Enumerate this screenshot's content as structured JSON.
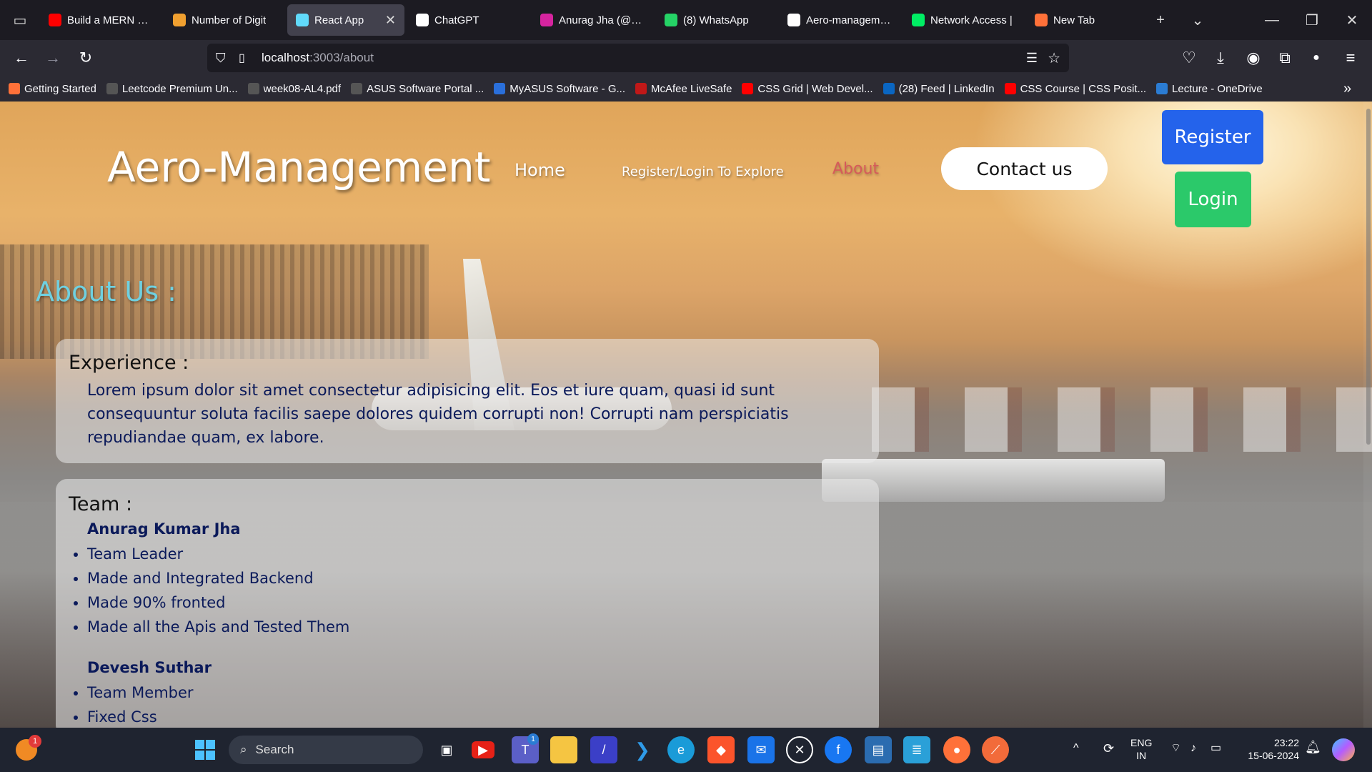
{
  "browser": {
    "tabs": [
      {
        "label": "Build a MERN Rea",
        "icon": "youtube-icon",
        "color": "#ff0000",
        "active": false
      },
      {
        "label": "Number of Digit",
        "icon": "code-icon",
        "color": "#f0a030",
        "active": false
      },
      {
        "label": "React App",
        "icon": "react-icon",
        "color": "#61dafb",
        "active": true
      },
      {
        "label": "ChatGPT",
        "icon": "chatgpt-icon",
        "color": "#ffffff",
        "active": false
      },
      {
        "label": "Anurag Jha (@anu",
        "icon": "instagram-icon",
        "color": "#d6249f",
        "active": false
      },
      {
        "label": "(8) WhatsApp",
        "icon": "whatsapp-icon",
        "color": "#25d366",
        "active": false
      },
      {
        "label": "Aero-managemen",
        "icon": "github-icon",
        "color": "#ffffff",
        "active": false
      },
      {
        "label": "Network Access |",
        "icon": "mongodb-icon",
        "color": "#00ed64",
        "active": false
      },
      {
        "label": "New Tab",
        "icon": "firefox-icon",
        "color": "#ff7139",
        "active": false
      }
    ],
    "url_host": "localhost",
    "url_path": ":3003/about",
    "bookmarks": [
      {
        "label": "Getting Started",
        "icon": "firefox-icon",
        "color": "#ff7139"
      },
      {
        "label": "Leetcode Premium Un...",
        "icon": "globe-icon",
        "color": "#555"
      },
      {
        "label": "week08-AL4.pdf",
        "icon": "globe-icon",
        "color": "#555"
      },
      {
        "label": "ASUS Software Portal ...",
        "icon": "globe-icon",
        "color": "#555"
      },
      {
        "label": "MyASUS Software - G...",
        "icon": "asus-icon",
        "color": "#2a6fdb"
      },
      {
        "label": "McAfee LiveSafe",
        "icon": "mcafee-icon",
        "color": "#c01818"
      },
      {
        "label": "CSS Grid | Web Devel...",
        "icon": "youtube-icon",
        "color": "#ff0000"
      },
      {
        "label": "(28) Feed | LinkedIn",
        "icon": "linkedin-icon",
        "color": "#0a66c2"
      },
      {
        "label": "CSS Course | CSS Posit...",
        "icon": "youtube-icon",
        "color": "#ff0000"
      },
      {
        "label": "Lecture - OneDrive",
        "icon": "onedrive-icon",
        "color": "#2b7cd3"
      }
    ]
  },
  "site": {
    "title": "Aero-Management",
    "nav": {
      "home": "Home",
      "explore": "Register/Login To Explore",
      "about": "About",
      "contact": "Contact us",
      "register": "Register",
      "login": "Login"
    },
    "about_heading": "About Us :",
    "experience": {
      "heading": "Experience :",
      "text": "Lorem ipsum dolor sit amet consectetur adipisicing elit. Eos et iure quam, quasi id sunt consequuntur soluta facilis saepe dolores quidem corrupti non! Corrupti nam perspiciatis repudiandae quam, ex labore."
    },
    "team": {
      "heading": "Team :",
      "members": [
        {
          "name": "Anurag Kumar Jha",
          "points": [
            "Team Leader",
            "Made and Integrated Backend",
            "Made 90% fronted",
            "Made all the Apis and Tested Them"
          ]
        },
        {
          "name": "Devesh Suthar",
          "points": [
            "Team Member",
            "Fixed Css"
          ]
        }
      ]
    },
    "colors": {
      "register": "#2463eb",
      "login": "#2bc96a",
      "about_active": "#d65a5a",
      "about_heading": "#6fd0e0"
    }
  },
  "taskbar": {
    "search_placeholder": "Search",
    "lang_top": "ENG",
    "lang_bottom": "IN",
    "time": "23:22",
    "date": "15-06-2024",
    "notification_badge": "1",
    "teams_badge": "1"
  }
}
